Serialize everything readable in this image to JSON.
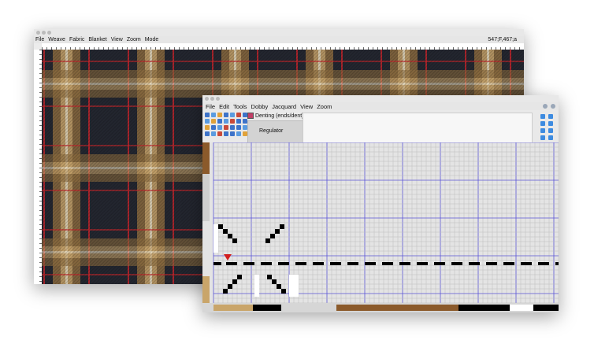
{
  "fabric_window": {
    "title": "",
    "menu": [
      "File",
      "Weave",
      "Fabric",
      "Blanket",
      "View",
      "Zoom",
      "Mode"
    ],
    "coordinates": "547;F,467;a"
  },
  "edit_window": {
    "title": "",
    "menu": [
      "File",
      "Edit",
      "Tools",
      "Dobby",
      "Jacquard",
      "View",
      "Zoom"
    ],
    "denting_label": "Denting (ends/dent)",
    "denting_value": "2",
    "regulator_label": "Regulator"
  },
  "colors": {
    "tartan_dark": "#23262f",
    "tartan_brown": "#8a6a3e",
    "tartan_tan": "#c9a56a",
    "tartan_cream": "#efe0bf",
    "tartan_red": "#c0262c",
    "grid_blue": "#5a55d6",
    "grid_cell": "#d9d9d9",
    "grid_line": "#bdbdbd",
    "warp_brown": "#8b5a2b",
    "warp_tan": "#c9a56a",
    "pointer_red": "#d21f1f"
  },
  "icons": {
    "denting_swatch": "color-swatch-icon",
    "pointer": "red-triangle-marker-icon"
  }
}
